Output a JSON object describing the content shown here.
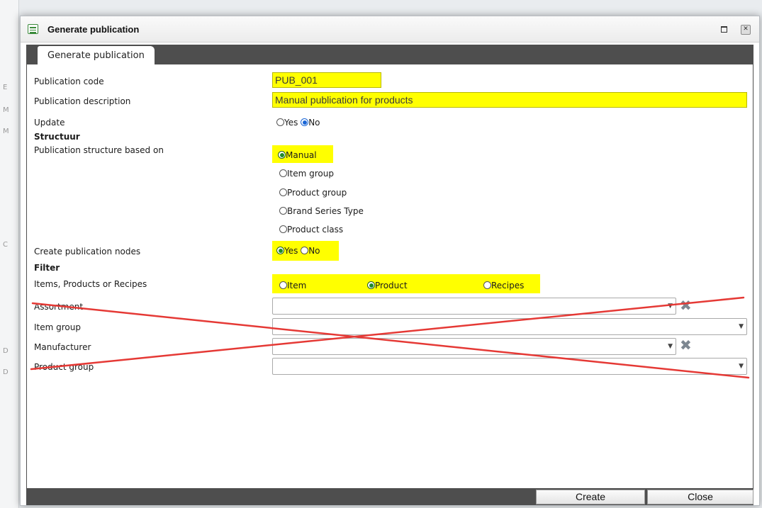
{
  "window": {
    "title": "Generate publication"
  },
  "tab": {
    "label": "Generate publication"
  },
  "form": {
    "publication_code": {
      "label": "Publication code",
      "value": "PUB_001"
    },
    "publication_description": {
      "label": "Publication description",
      "value": "Manual publication for products"
    },
    "update": {
      "label": "Update",
      "options": [
        "Yes",
        "No"
      ],
      "selected": "No"
    },
    "section_structure": "Structuur",
    "structure_based_on": {
      "label": "Publication structure based on",
      "options": [
        "Manual",
        "Item group",
        "Product group",
        "Brand Series Type",
        "Product class"
      ],
      "selected": "Manual"
    },
    "create_nodes": {
      "label": "Create publication nodes",
      "options": [
        "Yes",
        "No"
      ],
      "selected": "Yes"
    },
    "section_filter": "Filter",
    "items_products_recipes": {
      "label": "Items, Products or Recipes",
      "options": [
        "Item",
        "Product",
        "Recipes"
      ],
      "selected": "Product"
    },
    "assortment": {
      "label": "Assortment",
      "value": ""
    },
    "item_group": {
      "label": "Item group",
      "value": ""
    },
    "manufacturer": {
      "label": "Manufacturer",
      "value": ""
    },
    "product_group": {
      "label": "Product group",
      "value": ""
    }
  },
  "footer": {
    "create_label": "Create",
    "close_label": "Close"
  },
  "colors": {
    "highlight": "#ffff00",
    "bar": "#4e4e4e",
    "annotation": "#e53935"
  }
}
